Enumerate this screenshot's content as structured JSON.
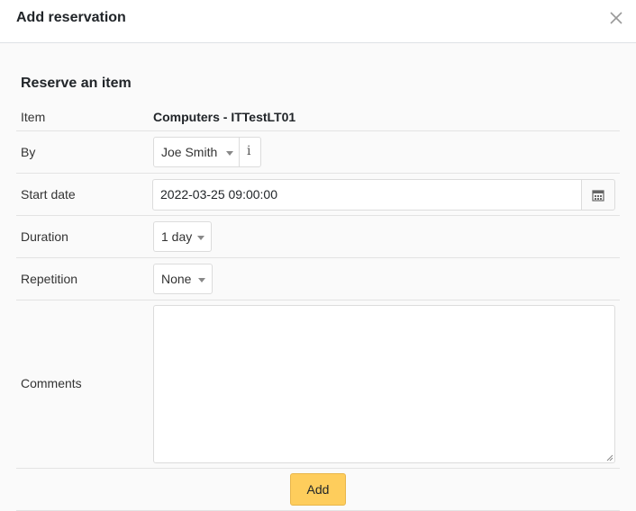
{
  "dialog": {
    "title": "Add reservation",
    "close_icon": "close-icon"
  },
  "form": {
    "section_title": "Reserve an item",
    "item": {
      "label": "Item",
      "value": "Computers - ITTestLT01"
    },
    "by": {
      "label": "By",
      "value": "Joe Smith",
      "info_symbol": "i"
    },
    "start_date": {
      "label": "Start date",
      "value": "2022-03-25 09:00:00",
      "icon": "calendar-icon"
    },
    "duration": {
      "label": "Duration",
      "value": "1 day"
    },
    "repetition": {
      "label": "Repetition",
      "value": "None"
    },
    "comments": {
      "label": "Comments",
      "value": ""
    },
    "submit_label": "Add"
  },
  "colors": {
    "accent_button": "#fecd5c",
    "border": "#dcdcdc",
    "body_bg": "#fafafa"
  }
}
